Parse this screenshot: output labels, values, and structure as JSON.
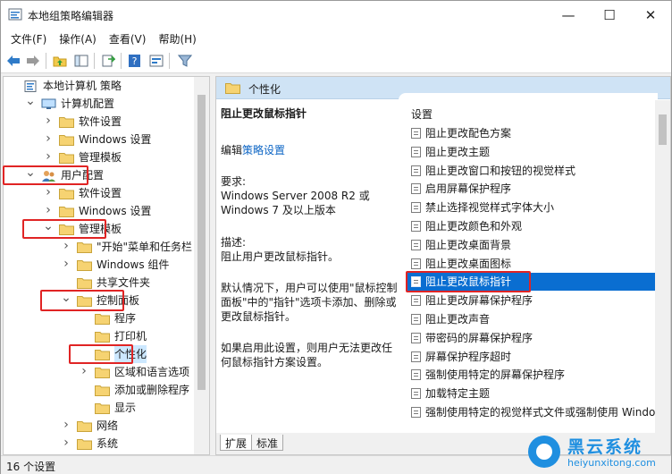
{
  "window": {
    "title": "本地组策略编辑器",
    "controls": {
      "minimize": "—",
      "maximize": "☐",
      "close": "✕"
    }
  },
  "menu": [
    "文件(F)",
    "操作(A)",
    "查看(V)",
    "帮助(H)"
  ],
  "toolbar": {
    "icons": [
      "back-icon",
      "forward-icon",
      "up-folder-icon",
      "show-hide-tree-icon",
      "export-list-icon",
      "help-icon",
      "properties-icon",
      "filter-icon"
    ]
  },
  "tree": [
    {
      "label": "本地计算机 策略",
      "icon": "computer-policy-icon",
      "level": 0,
      "twisty": ""
    },
    {
      "label": "计算机配置",
      "icon": "computer-icon",
      "level": 1,
      "twisty": "expanded"
    },
    {
      "label": "软件设置",
      "icon": "folder-icon",
      "level": 2,
      "twisty": "collapsed"
    },
    {
      "label": "Windows 设置",
      "icon": "folder-icon",
      "level": 2,
      "twisty": "collapsed"
    },
    {
      "label": "管理模板",
      "icon": "folder-icon",
      "level": 2,
      "twisty": "collapsed"
    },
    {
      "label": "用户配置",
      "icon": "user-icon",
      "level": 1,
      "twisty": "expanded"
    },
    {
      "label": "软件设置",
      "icon": "folder-icon",
      "level": 2,
      "twisty": "collapsed"
    },
    {
      "label": "Windows 设置",
      "icon": "folder-icon",
      "level": 2,
      "twisty": "collapsed"
    },
    {
      "label": "管理模板",
      "icon": "folder-icon",
      "level": 2,
      "twisty": "expanded"
    },
    {
      "label": "\"开始\"菜单和任务栏",
      "icon": "folder-icon",
      "level": 3,
      "twisty": "collapsed"
    },
    {
      "label": "Windows 组件",
      "icon": "folder-icon",
      "level": 3,
      "twisty": "collapsed"
    },
    {
      "label": "共享文件夹",
      "icon": "folder-icon",
      "level": 3,
      "twisty": ""
    },
    {
      "label": "控制面板",
      "icon": "folder-icon",
      "level": 3,
      "twisty": "expanded"
    },
    {
      "label": "程序",
      "icon": "folder-icon",
      "level": 4,
      "twisty": ""
    },
    {
      "label": "打印机",
      "icon": "folder-icon",
      "level": 4,
      "twisty": ""
    },
    {
      "label": "个性化",
      "icon": "folder-icon",
      "level": 4,
      "twisty": "",
      "selected": true
    },
    {
      "label": "区域和语言选项",
      "icon": "folder-icon",
      "level": 4,
      "twisty": "collapsed"
    },
    {
      "label": "添加或删除程序",
      "icon": "folder-icon",
      "level": 4,
      "twisty": ""
    },
    {
      "label": "显示",
      "icon": "folder-icon",
      "level": 4,
      "twisty": ""
    },
    {
      "label": "网络",
      "icon": "folder-icon",
      "level": 3,
      "twisty": "collapsed"
    },
    {
      "label": "系统",
      "icon": "folder-icon",
      "level": 3,
      "twisty": "collapsed"
    }
  ],
  "right_pane": {
    "header": "个性化",
    "description": {
      "title": "阻止更改鼠标指针",
      "edit_prefix": "编辑",
      "edit_link": "策略设置",
      "requirements_label": "要求:",
      "requirements_text": "Windows Server 2008 R2 或 Windows 7 及以上版本",
      "description_label": "描述:",
      "description_text": "阻止用户更改鼠标指针。",
      "default_text": "默认情况下，用户可以使用\"鼠标控制面板\"中的\"指针\"选项卡添加、删除或更改鼠标指针。",
      "enabled_text": "如果启用此设置，则用户无法更改任何鼠标指针方案设置。"
    },
    "list_header": "设置",
    "settings": [
      "阻止更改配色方案",
      "阻止更改主题",
      "阻止更改窗口和按钮的视觉样式",
      "启用屏幕保护程序",
      "禁止选择视觉样式字体大小",
      "阻止更改颜色和外观",
      "阻止更改桌面背景",
      "阻止更改桌面图标",
      "阻止更改鼠标指针",
      "阻止更改屏幕保护程序",
      "阻止更改声音",
      "带密码的屏幕保护程序",
      "屏幕保护程序超时",
      "强制使用特定的屏幕保护程序",
      "加载特定主题",
      "强制使用特定的视觉样式文件或强制使用 Windo"
    ],
    "selected_setting": "阻止更改鼠标指针",
    "tabs": [
      "扩展",
      "标准"
    ]
  },
  "status": "16 个设置",
  "watermark": {
    "title": "黑云系统",
    "url": "heiyunxitong.com"
  },
  "colors": {
    "highlight": "#e02424",
    "selection": "#0a6ed1",
    "header_bg": "#cfe3f5"
  }
}
